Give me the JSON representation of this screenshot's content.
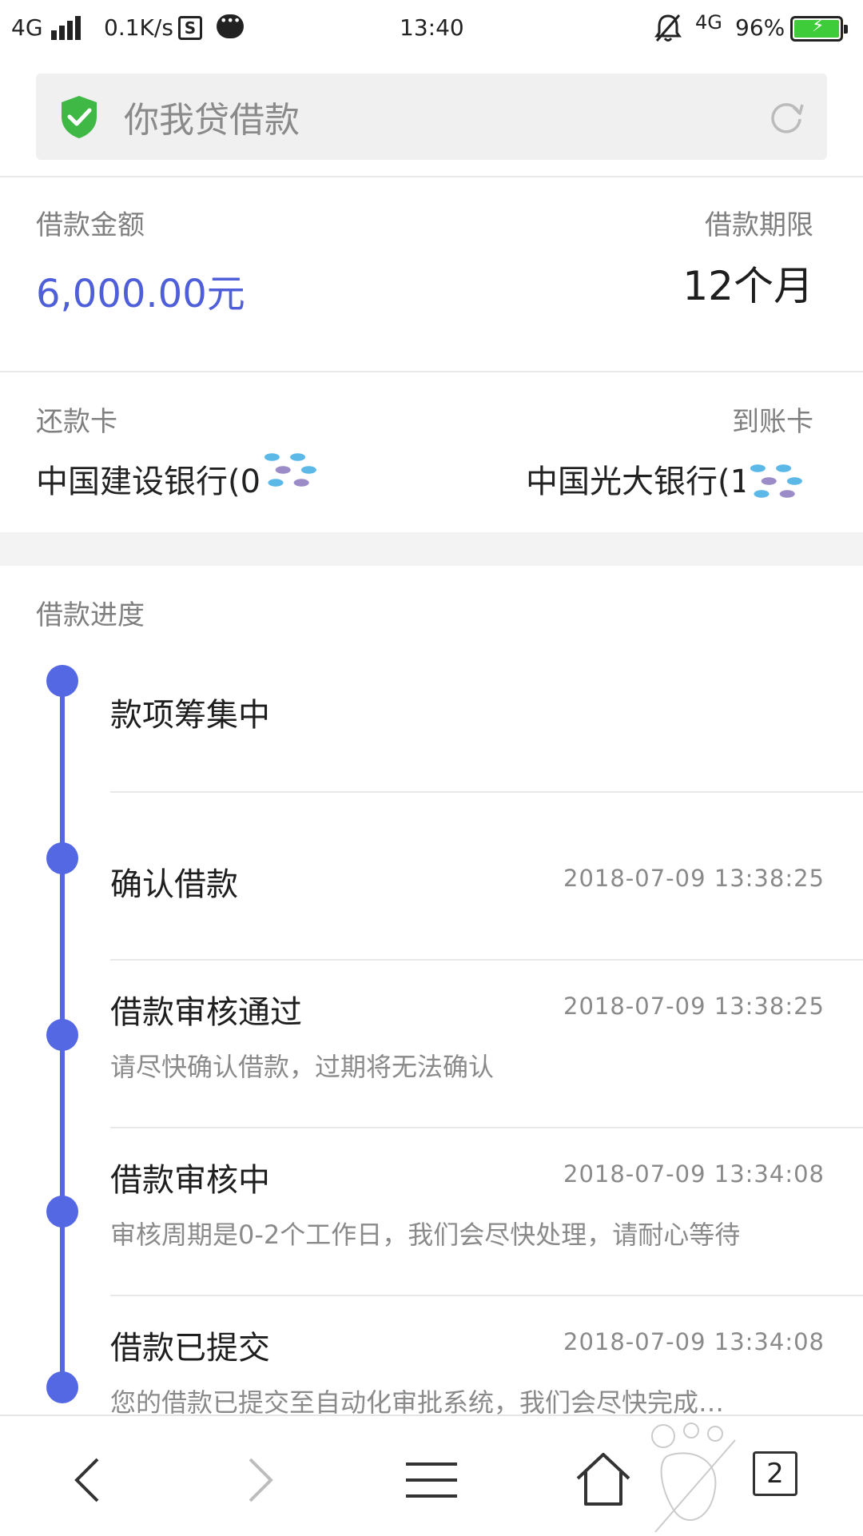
{
  "status_bar": {
    "network": "4G",
    "speed": "0.1K/s",
    "s_icon": "S",
    "time": "13:40",
    "network_right": "4G",
    "battery": "96%"
  },
  "address_bar": {
    "title": "你我贷借款",
    "icons": [
      "shield-check-icon",
      "refresh-icon"
    ]
  },
  "loan": {
    "amount_label": "借款金额",
    "amount_value": "6,000.00元",
    "term_label": "借款期限",
    "term_value": "12个月",
    "repay_card_label": "还款卡",
    "repay_card_value": "中国建设银行(0",
    "receive_card_label": "到账卡",
    "receive_card_value": "中国光大银行(1"
  },
  "progress": {
    "title": "借款进度",
    "steps": [
      {
        "title": "款项筹集中",
        "time": "",
        "desc": ""
      },
      {
        "title": "确认借款",
        "time": "2018-07-09 13:38:25",
        "desc": ""
      },
      {
        "title": "借款审核通过",
        "time": "2018-07-09 13:38:25",
        "desc": "请尽快确认借款，过期将无法确认"
      },
      {
        "title": "借款审核中",
        "time": "2018-07-09 13:34:08",
        "desc": "审核周期是0-2个工作日，我们会尽快处理，请耐心等待"
      },
      {
        "title": "借款已提交",
        "time": "2018-07-09 13:34:08",
        "desc": "您的借款已提交至自动化审批系统，我们会尽快完成…"
      }
    ]
  },
  "bottom_nav": {
    "tab_count": "2",
    "icons": [
      "back-icon",
      "forward-icon",
      "menu-icon",
      "home-icon",
      "tabs-icon"
    ]
  },
  "colors": {
    "accent": "#5468e4",
    "amount": "#4e5fd9",
    "shield": "#3fb846",
    "battery": "#3fcc3a"
  }
}
